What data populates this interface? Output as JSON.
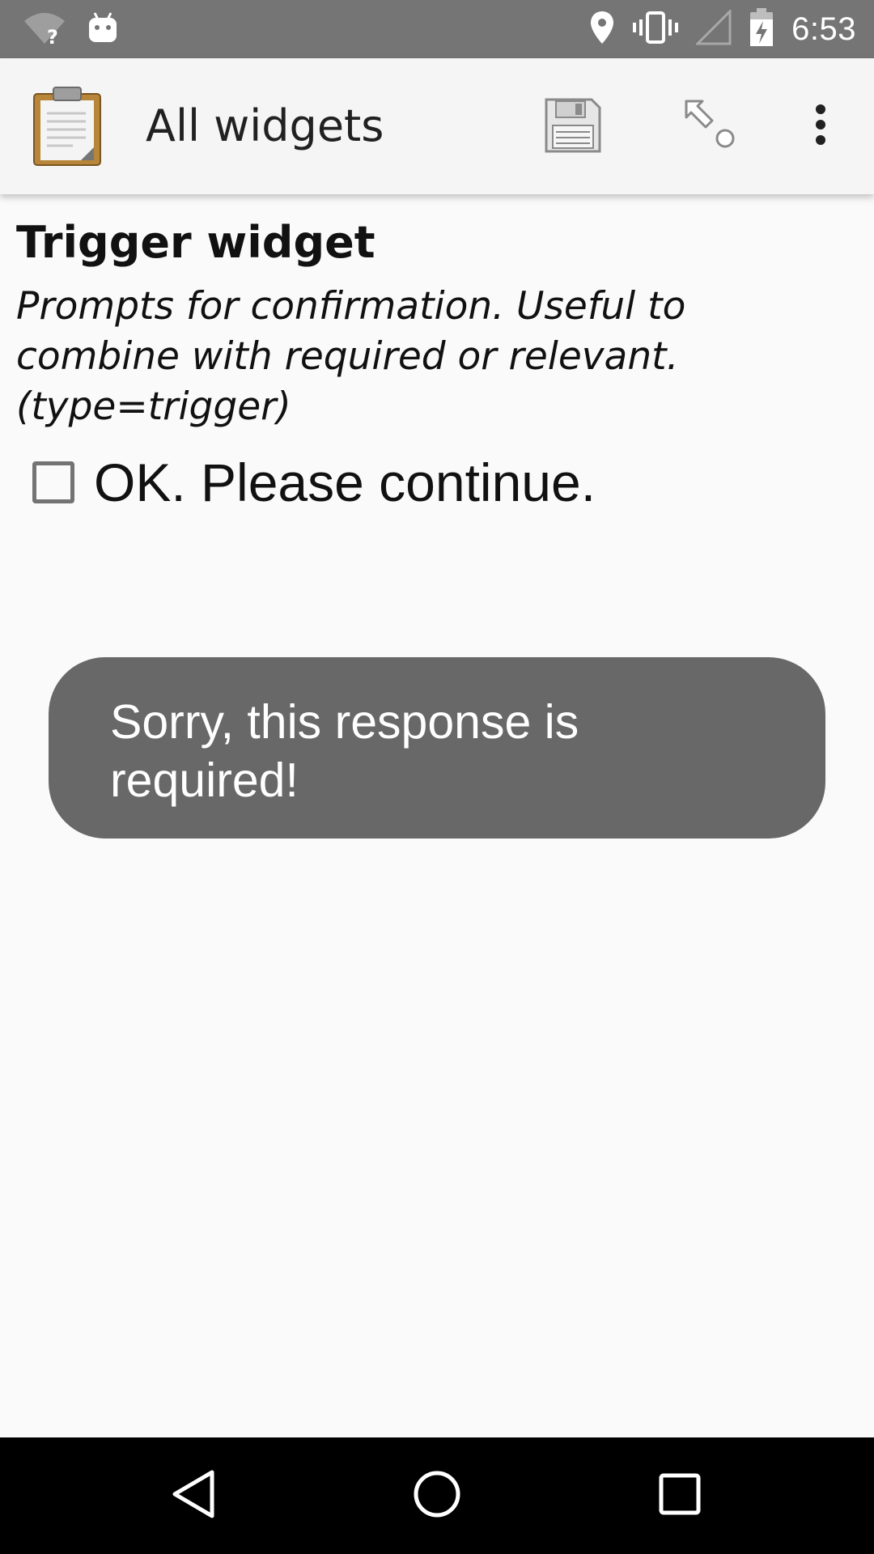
{
  "status_bar": {
    "time": "6:53",
    "icons": [
      "wifi-unknown-icon",
      "android-debug-icon",
      "location-icon",
      "vibrate-icon",
      "no-signal-icon",
      "battery-charging-icon"
    ]
  },
  "app_bar": {
    "title": "All widgets",
    "logo_icon": "clipboard-form-icon",
    "actions": [
      "save-icon",
      "jump-to-question-icon",
      "more-options-icon"
    ]
  },
  "question": {
    "title": "Trigger widget",
    "hint": "Prompts for confirmation. Useful to combine with required or relevant. (type=trigger)",
    "trigger_label": "OK. Please continue.",
    "checked": false
  },
  "toast": {
    "message": "Sorry, this response is required!"
  },
  "nav_bar": {
    "buttons": [
      "back-icon",
      "home-icon",
      "recents-icon"
    ]
  },
  "colors": {
    "status_bar": "#757575",
    "app_bar": "#f5f5f5",
    "background": "#fafafa",
    "toast": "#686868",
    "nav_bar": "#000000"
  }
}
